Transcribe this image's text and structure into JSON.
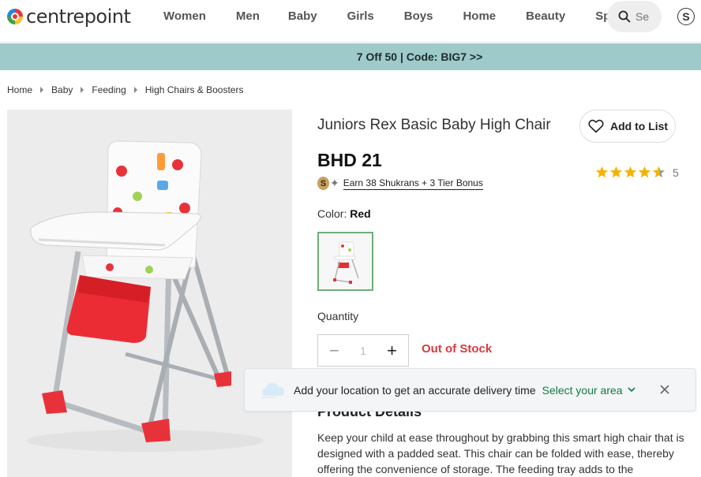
{
  "header": {
    "logo_text": "centrepoint",
    "nav": [
      "Women",
      "Men",
      "Baby",
      "Girls",
      "Boys",
      "Home",
      "Beauty",
      "Sports"
    ],
    "search_placeholder": "Se",
    "shukran_symbol": "S"
  },
  "promo": {
    "text": "7 Off 50 | Code: BIG7 >>"
  },
  "breadcrumb": [
    "Home",
    "Baby",
    "Feeding",
    "High Chairs & Boosters"
  ],
  "product": {
    "title": "Juniors Rex Basic Baby High Chair",
    "add_to_list": "Add to List",
    "price": "BHD 21",
    "rating": 4.5,
    "rating_count": "5",
    "shukrans_coin": "S",
    "shukrans_text": "Earn 38 Shukrans + 3  Tier Bonus",
    "color_label": "Color:",
    "color_value": "Red",
    "quantity_label": "Quantity",
    "quantity_value": "1",
    "stock_status": "Out of Stock",
    "details_title": "Product Details",
    "details_text": "Keep your child at ease throughout by grabbing this smart high chair that is designed with a padded seat. This chair can be folded with ease, thereby offering the convenience of storage. The feeding tray adds to the"
  },
  "toast": {
    "message": "Add your location to get an accurate delivery time",
    "link": "Select your area"
  },
  "colors": {
    "promo_bg": "#9ecaca",
    "out_of_stock": "#d9393e",
    "link_green": "#137a45",
    "star": "#f5b301"
  }
}
